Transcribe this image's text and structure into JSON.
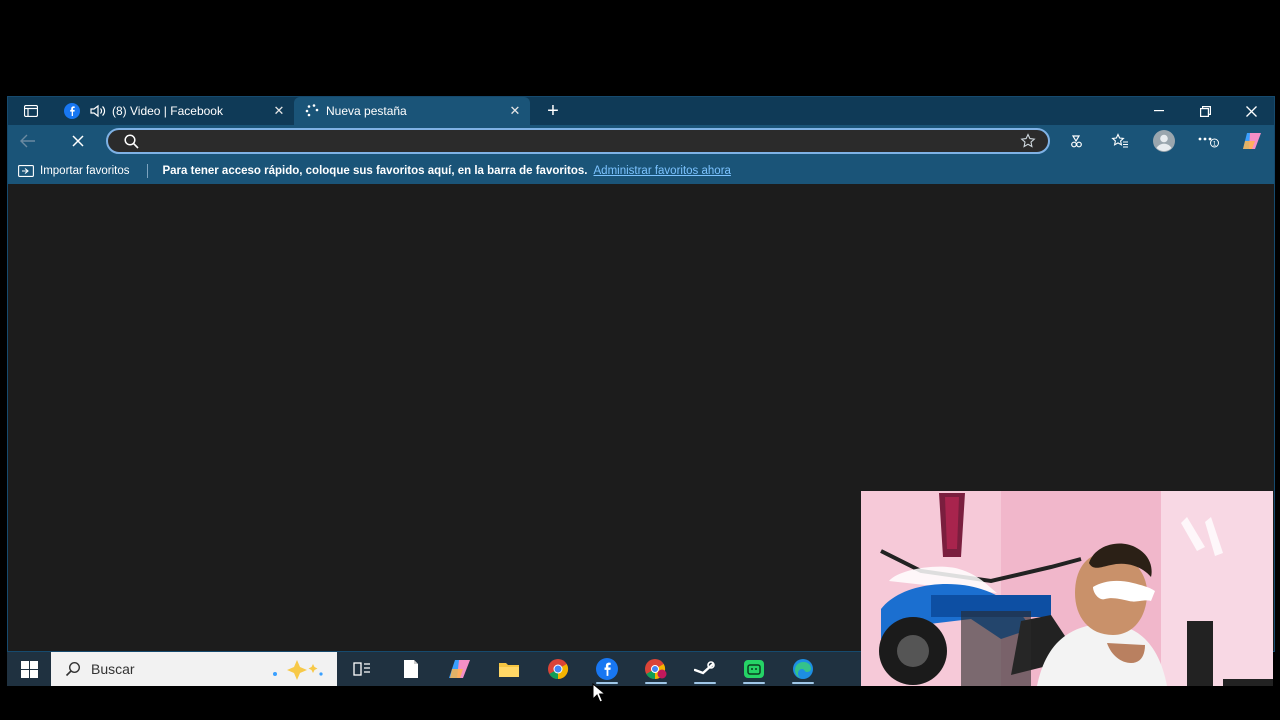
{
  "browser": {
    "tabs": [
      {
        "label": "(8) Video | Facebook",
        "favicon": "facebook-icon",
        "audio": "speaker-icon",
        "active": false
      },
      {
        "label": "Nueva pestaña",
        "favicon": "loading-icon",
        "active": true
      }
    ],
    "address_bar": {
      "value": "",
      "placeholder": ""
    },
    "favorites_bar": {
      "import_label": "Importar favoritos",
      "message": "Para tener acceso rápido, coloque sus favoritos aquí, en la barra de favoritos.",
      "link": "Administrar favoritos ahora"
    }
  },
  "taskbar": {
    "search_placeholder": "Buscar",
    "icons": [
      "task-view-icon",
      "file-icon",
      "copilot-icon",
      "file-explorer-icon",
      "chrome-icon",
      "facebook-icon",
      "chrome-profile-icon",
      "steam-icon",
      "whatsapp-icon",
      "edge-icon"
    ]
  },
  "colors": {
    "tab_bar": "#0f3a57",
    "toolbar": "#1a5478",
    "content": "#1c1c1c",
    "link": "#7cc3ff"
  }
}
